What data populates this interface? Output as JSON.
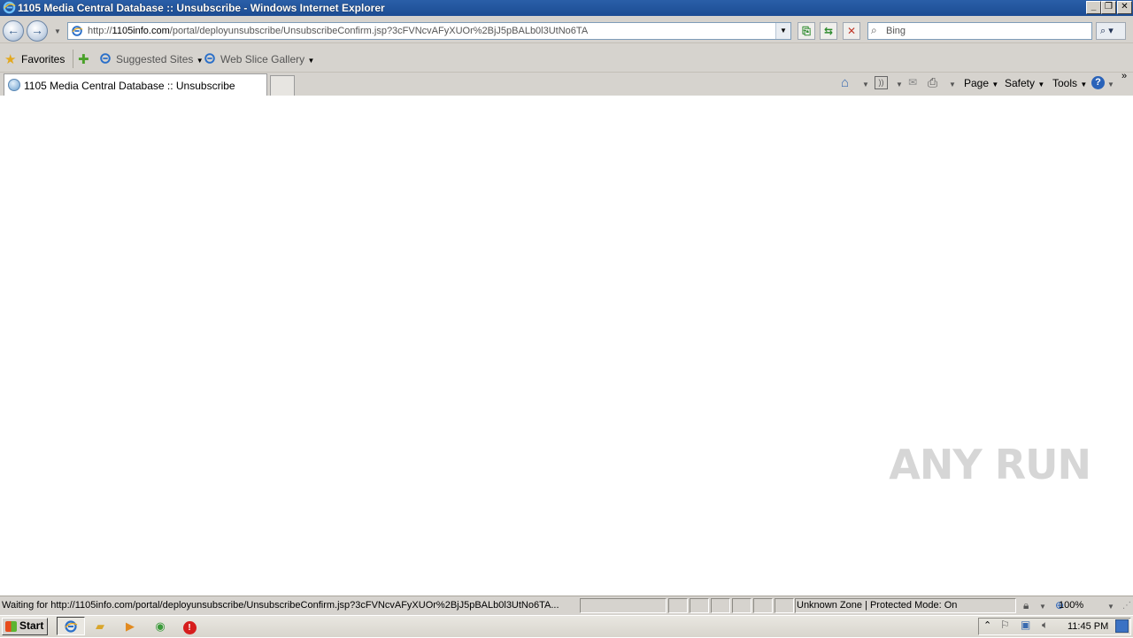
{
  "window": {
    "title": "1105 Media Central Database :: Unsubscribe - Windows Internet Explorer",
    "minimize_glyph": "_",
    "restore_glyph": "❐",
    "close_glyph": "✕"
  },
  "address_bar": {
    "scheme": "http://",
    "host": "1105info.com",
    "path": "/portal/deployunsubscribe/UnsubscribeConfirm.jsp?3cFVNcvAFyXUOr%2BjJ5pBALb0l3UtNo6TA"
  },
  "search": {
    "placeholder": "Bing"
  },
  "favorites_bar": {
    "favorites_label": "Favorites",
    "items": [
      {
        "label": "Suggested Sites"
      },
      {
        "label": "Web Slice Gallery"
      }
    ]
  },
  "tabs": [
    {
      "label": "1105 Media Central Database :: Unsubscribe",
      "active": true
    }
  ],
  "command_bar": {
    "page_label": "Page",
    "safety_label": "Safety",
    "tools_label": "Tools"
  },
  "status_bar": {
    "text": "Waiting for http://1105info.com/portal/deployunsubscribe/UnsubscribeConfirm.jsp?3cFVNcvAFyXUOr%2BjJ5pBALb0l3UtNo6TA...",
    "zone": "Unknown Zone | Protected Mode: On",
    "zoom": "100%"
  },
  "taskbar": {
    "start_label": "Start",
    "clock": "11:45 PM"
  },
  "watermark": "ANY RUN",
  "icons": {
    "back": "back-arrow-icon",
    "forward": "forward-arrow-icon",
    "refresh": "refresh-icon",
    "stop": "stop-icon",
    "search": "magnifier-icon",
    "home": "home-icon",
    "feeds": "rss-feed-icon",
    "mail": "mail-icon",
    "print": "print-icon",
    "help": "help-icon"
  },
  "colors": {
    "titlebar": "#1c4c93",
    "chrome": "#d6d3ce",
    "stop_red": "#c0392b"
  }
}
